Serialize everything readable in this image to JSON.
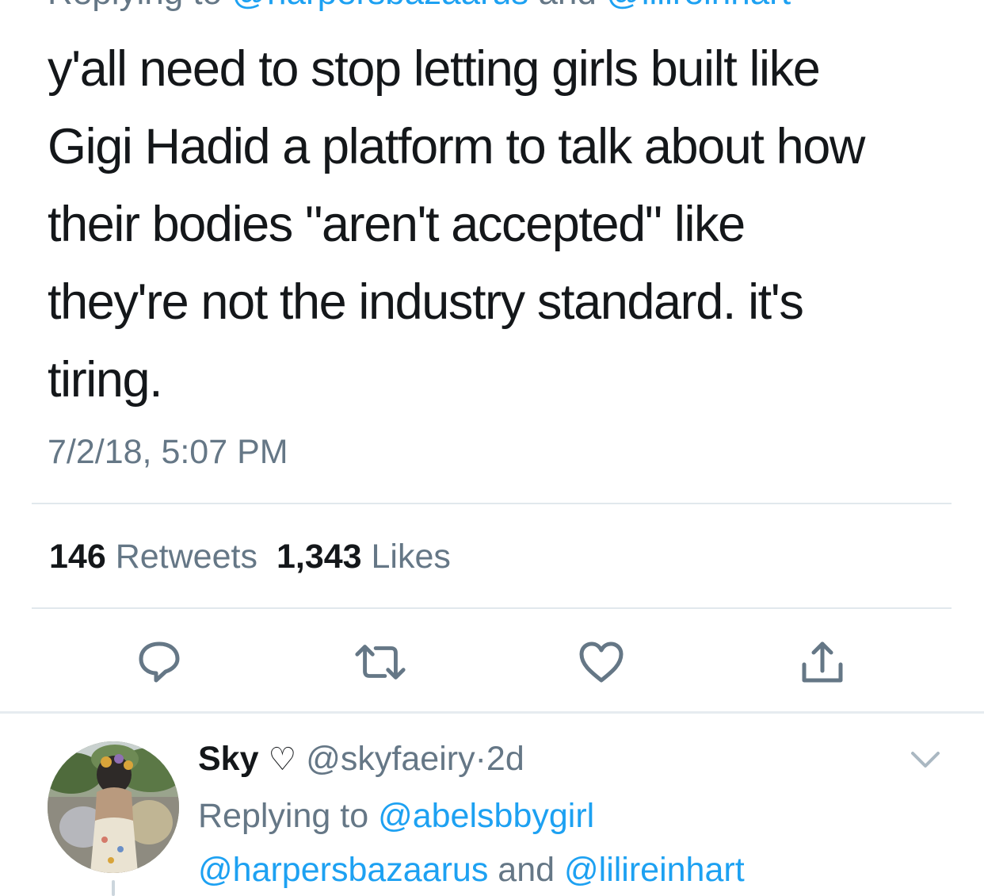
{
  "top_cut": {
    "prefix": "Replying to ",
    "mention1": "@harpersbazaarus",
    "and": " and ",
    "mention2": "@lilireinhart"
  },
  "tweet": {
    "text": "y'all need to stop letting girls built like\nGigi Hadid a platform to talk about how\ntheir bodies \"aren't accepted\" like\nthey're not the industry standard. it's\ntiring.",
    "timestamp": "7/2/18, 5:07 PM",
    "retweets_count": "146",
    "retweets_label": "Retweets",
    "likes_count": "1,343",
    "likes_label": "Likes"
  },
  "actions": [
    {
      "name": "reply",
      "icon": "reply-icon"
    },
    {
      "name": "retweet",
      "icon": "retweet-icon"
    },
    {
      "name": "like",
      "icon": "heart-icon"
    },
    {
      "name": "share",
      "icon": "share-icon"
    }
  ],
  "reply": {
    "name": "Sky",
    "name_emoji": "♡",
    "handle": "@skyfaeiry",
    "separator": "·",
    "age": "2d",
    "replying_prefix": "Replying to ",
    "mention1": "@abelsbbygirl",
    "mention2": "@harpersbazaarus",
    "and": " and ",
    "mention3": "@lilireinhart"
  },
  "colors": {
    "text": "#14171a",
    "secondary": "#657786",
    "accent": "#1da1f2",
    "divider": "#e1e8ed"
  }
}
